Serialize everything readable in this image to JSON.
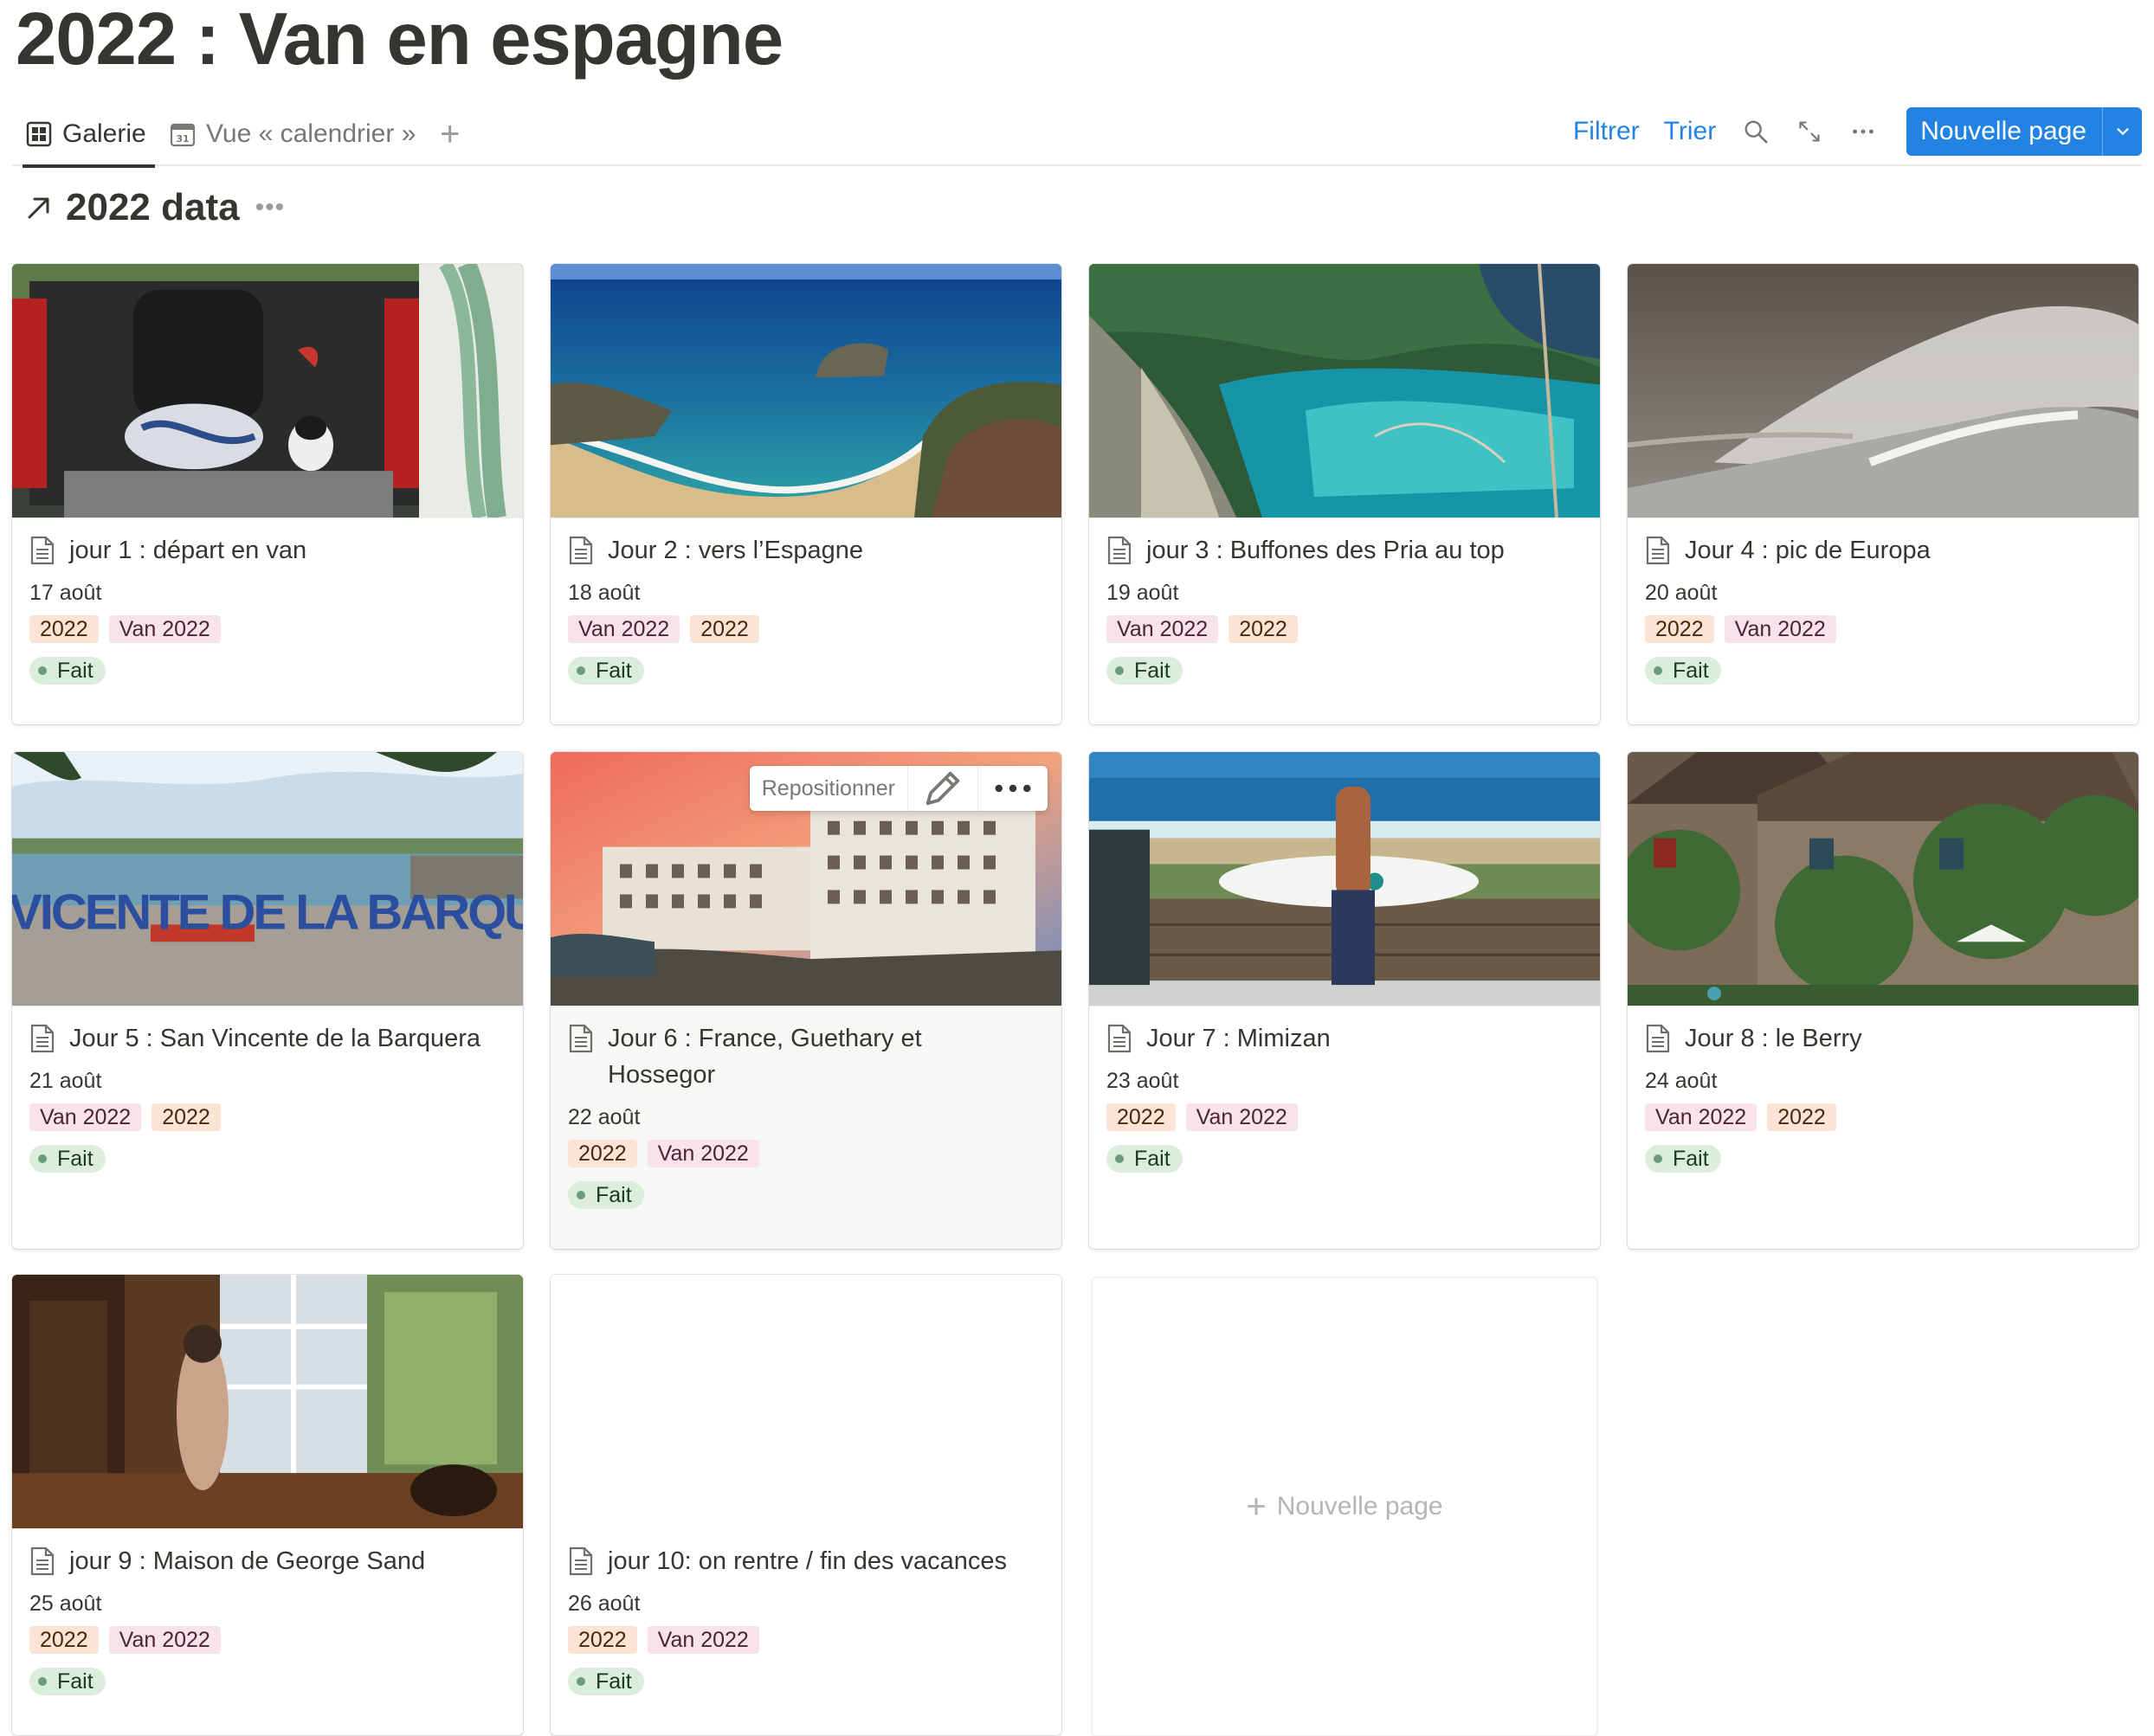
{
  "page": {
    "title": "2022 : Van en espagne"
  },
  "views": {
    "tabs": [
      {
        "label": "Galerie",
        "icon": "gallery-icon",
        "active": true
      },
      {
        "label": "Vue « calendrier »",
        "icon": "calendar-icon",
        "active": false
      }
    ],
    "add_view_icon": "plus-icon"
  },
  "toolbar": {
    "filter_label": "Filtrer",
    "sort_label": "Trier",
    "search_icon": "search-icon",
    "expand_icon": "expand-icon",
    "more_icon": "more-icon",
    "new_page_label": "Nouvelle page",
    "accent_color": "#2383e2"
  },
  "database": {
    "title": "2022 data",
    "icon": "linked-arrow-icon"
  },
  "cards": [
    {
      "title": "jour 1 : départ en van",
      "date": "17 août",
      "tags": [
        "2022",
        "Van 2022"
      ],
      "status": "Fait",
      "cover": "van-trunk-cat"
    },
    {
      "title": "Jour 2 : vers l’Espagne",
      "date": "18 août",
      "tags": [
        "Van 2022",
        "2022"
      ],
      "status": "Fait",
      "cover": "beach-cove"
    },
    {
      "title": "jour 3 : Buffones des Pria au top",
      "date": "19 août",
      "tags": [
        "Van 2022",
        "2022"
      ],
      "status": "Fait",
      "cover": "turquoise-inlet"
    },
    {
      "title": "Jour 4 : pic de Europa",
      "date": "20 août",
      "tags": [
        "2022",
        "Van 2022"
      ],
      "status": "Fait",
      "cover": "crashing-wave"
    },
    {
      "title": "Jour 5 : San Vincente de la Barquera",
      "date": "21 août",
      "tags": [
        "Van 2022",
        "2022"
      ],
      "status": "Fait",
      "cover": "san-vicente-sign",
      "cover_text": "SAN VICENTE DE LA BARQUERA"
    },
    {
      "title": "Jour 6 : France, Guethary et Hossegor",
      "date": "22 août",
      "tags": [
        "2022",
        "Van 2022"
      ],
      "status": "Fait",
      "cover": "sunset-buildings"
    },
    {
      "title": "Jour 7 : Mimizan",
      "date": "23 août",
      "tags": [
        "2022",
        "Van 2022"
      ],
      "status": "Fait",
      "cover": "surfer"
    },
    {
      "title": "Jour 8 : le Berry",
      "date": "24 août",
      "tags": [
        "Van 2022",
        "2022"
      ],
      "status": "Fait",
      "cover": "ivy-house"
    },
    {
      "title": "jour 9 : Maison de George Sand",
      "date": "25 août",
      "tags": [
        "2022",
        "Van 2022"
      ],
      "status": "Fait",
      "cover": "window-interior"
    },
    {
      "title": "jour 10: on rentre / fin des vacances",
      "date": "26 août",
      "tags": [
        "2022",
        "Van 2022"
      ],
      "status": "Fait",
      "cover": ""
    }
  ],
  "hover_toolbar": {
    "reposition_label": "Repositionner",
    "edit_icon": "pencil-icon",
    "more_icon": "more-icon"
  },
  "new_card_label": "Nouvelle page",
  "tag_colors": {
    "2022": "#fbe4d5",
    "Van 2022": "#f9e3ea"
  },
  "status_color": "#dbeddb"
}
